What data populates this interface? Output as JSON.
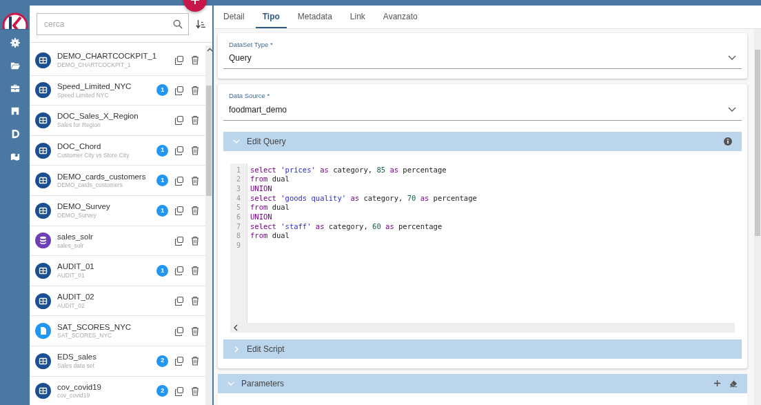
{
  "search": {
    "placeholder": "cerca"
  },
  "datasets": [
    {
      "title": "DEMO_CHARTCOCKPIT_1",
      "subtitle": "DEMO_CHARTCOCKPIT_1",
      "kind": "table"
    },
    {
      "title": "Speed_Limited_NYC",
      "subtitle": "Speed Limited NYC",
      "kind": "table",
      "badge": "1"
    },
    {
      "title": "DOC_Sales_X_Region",
      "subtitle": "Sales for Region",
      "kind": "table"
    },
    {
      "title": "DOC_Chord",
      "subtitle": "Customer City vs Store City",
      "kind": "table",
      "badge": "1"
    },
    {
      "title": "DEMO_cards_customers",
      "subtitle": "DEMO_cards_customers",
      "kind": "table",
      "badge": "1"
    },
    {
      "title": "DEMO_Survey",
      "subtitle": "DEMO_Survey",
      "kind": "table",
      "badge": "1"
    },
    {
      "title": "sales_solr",
      "subtitle": "sales_solr",
      "kind": "solr"
    },
    {
      "title": "AUDIT_01",
      "subtitle": "AUDIT_01",
      "kind": "table",
      "badge": "1"
    },
    {
      "title": "AUDIT_02",
      "subtitle": "AUDIT_02",
      "kind": "table"
    },
    {
      "title": "SAT_SCORES_NYC",
      "subtitle": "SAT_SCORES_NYC",
      "kind": "file"
    },
    {
      "title": "EDS_sales",
      "subtitle": "Sales data set",
      "kind": "table",
      "badge": "2"
    },
    {
      "title": "cov_covid19",
      "subtitle": "cov_covid19",
      "kind": "table",
      "badge": "2"
    }
  ],
  "tabs": [
    {
      "label": "Detail",
      "selected": false
    },
    {
      "label": "Tipo",
      "selected": true
    },
    {
      "label": "Metadata",
      "selected": false
    },
    {
      "label": "Link",
      "selected": false
    },
    {
      "label": "Avanzato",
      "selected": false
    }
  ],
  "dataset_type": {
    "label": "DataSet Type *",
    "value": "Query"
  },
  "data_source": {
    "label": "Data Source *",
    "value": "foodmart_demo"
  },
  "edit_query": {
    "title": "Edit Query",
    "expanded": true,
    "code": [
      [
        {
          "text": "select",
          "kind": "keyword"
        },
        {
          "text": "'prices'",
          "kind": "string"
        },
        {
          "text": "as",
          "kind": "keyword"
        },
        {
          "text": "category,",
          "kind": "plain"
        },
        {
          "text": "85",
          "kind": "number"
        },
        {
          "text": "as",
          "kind": "keyword"
        },
        {
          "text": "percentage",
          "kind": "plain"
        }
      ],
      [
        {
          "text": "from",
          "kind": "keyword"
        },
        {
          "text": "dual",
          "kind": "plain"
        }
      ],
      [
        {
          "text": "UNION",
          "kind": "keyword"
        }
      ],
      [
        {
          "text": "select",
          "kind": "keyword"
        },
        {
          "text": "'goods quality'",
          "kind": "string"
        },
        {
          "text": "as",
          "kind": "keyword"
        },
        {
          "text": "category,",
          "kind": "plain"
        },
        {
          "text": "70",
          "kind": "number"
        },
        {
          "text": "as",
          "kind": "keyword"
        },
        {
          "text": "percentage",
          "kind": "plain"
        }
      ],
      [
        {
          "text": "from",
          "kind": "keyword"
        },
        {
          "text": "dual",
          "kind": "plain"
        }
      ],
      [
        {
          "text": "UNION",
          "kind": "keyword"
        }
      ],
      [
        {
          "text": "select",
          "kind": "keyword"
        },
        {
          "text": "'staff'",
          "kind": "string"
        },
        {
          "text": "as",
          "kind": "keyword"
        },
        {
          "text": "category,",
          "kind": "plain"
        },
        {
          "text": "60",
          "kind": "number"
        },
        {
          "text": "as",
          "kind": "keyword"
        },
        {
          "text": "percentage",
          "kind": "plain"
        }
      ],
      [
        {
          "text": "from",
          "kind": "keyword"
        },
        {
          "text": "dual",
          "kind": "plain"
        }
      ]
    ],
    "line_numbers": [
      "1",
      "2",
      "3",
      "4",
      "5",
      "6",
      "7",
      "8",
      "9"
    ]
  },
  "edit_script": {
    "title": "Edit Script",
    "expanded": false
  },
  "parameters": {
    "title": "Parameters",
    "expanded": true
  }
}
